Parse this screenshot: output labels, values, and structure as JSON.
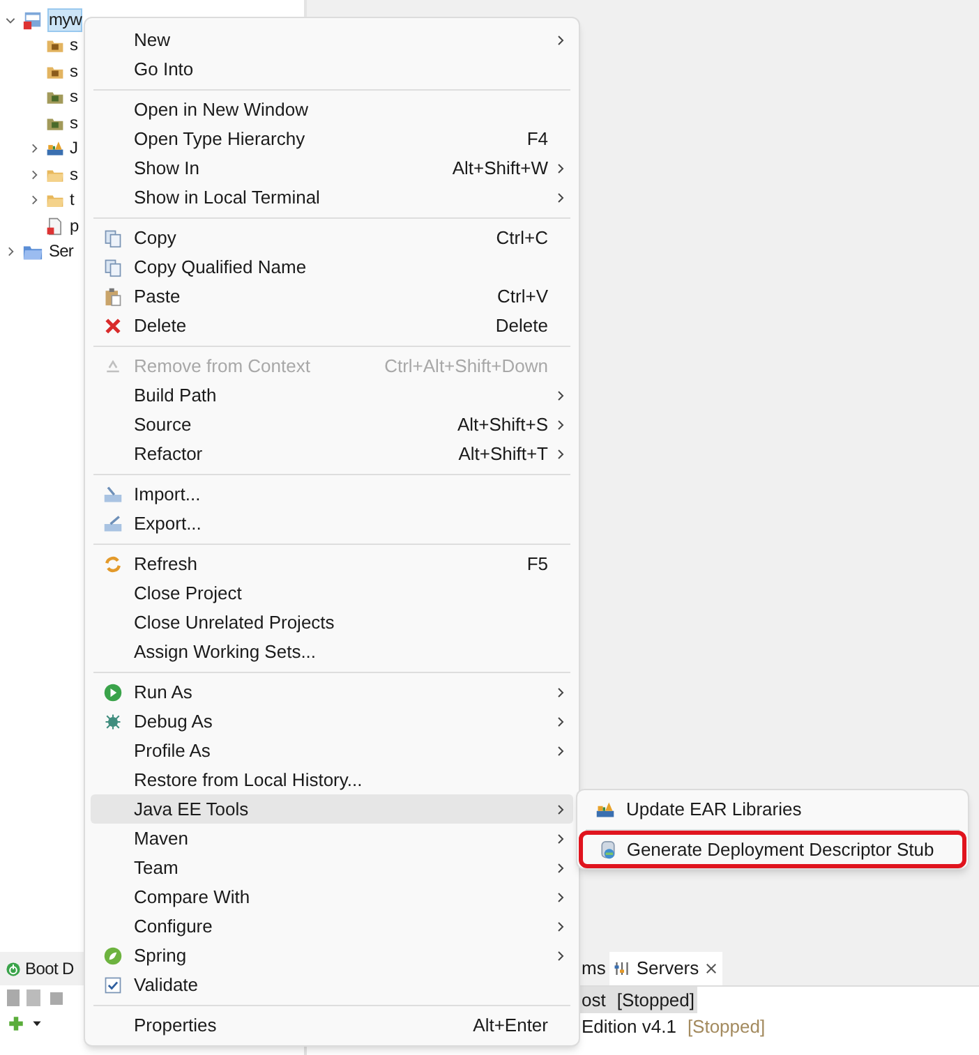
{
  "project_tree": {
    "items": [
      {
        "label": "myw",
        "kind": "webproject",
        "selected": true,
        "expanded": true,
        "children": [
          {
            "label": "s",
            "kind": "package"
          },
          {
            "label": "s",
            "kind": "package"
          },
          {
            "label": "s",
            "kind": "resources"
          },
          {
            "label": "s",
            "kind": "resources"
          },
          {
            "label": "J",
            "kind": "library",
            "expanded": false
          },
          {
            "label": "s",
            "kind": "folder",
            "expanded": false
          },
          {
            "label": "t",
            "kind": "folder",
            "expanded": false
          },
          {
            "label": "p",
            "kind": "file"
          }
        ]
      },
      {
        "label": "Ser",
        "kind": "serverfolder",
        "selected": false,
        "expanded": false
      }
    ]
  },
  "boot_panel": {
    "tab": "Boot D"
  },
  "servers_panel": {
    "tabs": [
      {
        "label": "ms",
        "selected": false
      },
      {
        "label": "Servers",
        "selected": true
      }
    ],
    "rows": [
      {
        "name": "ost",
        "state": "[Stopped]",
        "selected": true
      },
      {
        "name": "Edition v4.1",
        "state": "[Stopped]",
        "selected": false
      }
    ]
  },
  "context_menu": {
    "items": [
      {
        "kind": "plain",
        "label": "New",
        "submenu": true
      },
      {
        "kind": "plain",
        "label": "Go Into"
      },
      {
        "kind": "separator"
      },
      {
        "kind": "plain",
        "label": "Open in New Window"
      },
      {
        "kind": "plain",
        "label": "Open Type Hierarchy",
        "shortcut": "F4"
      },
      {
        "kind": "plain",
        "label": "Show In",
        "shortcut": "Alt+Shift+W",
        "submenu": true
      },
      {
        "kind": "plain",
        "label": "Show in Local Terminal",
        "submenu": true
      },
      {
        "kind": "separator"
      },
      {
        "kind": "copy",
        "label": "Copy",
        "shortcut": "Ctrl+C"
      },
      {
        "kind": "copy",
        "label": "Copy Qualified Name"
      },
      {
        "kind": "paste",
        "label": "Paste",
        "shortcut": "Ctrl+V"
      },
      {
        "kind": "delete",
        "label": "Delete",
        "shortcut": "Delete"
      },
      {
        "kind": "separator"
      },
      {
        "kind": "remove",
        "label": "Remove from Context",
        "shortcut": "Ctrl+Alt+Shift+Down",
        "disabled": true
      },
      {
        "kind": "plain",
        "label": "Build Path",
        "submenu": true
      },
      {
        "kind": "plain",
        "label": "Source",
        "shortcut": "Alt+Shift+S",
        "submenu": true
      },
      {
        "kind": "plain",
        "label": "Refactor",
        "shortcut": "Alt+Shift+T",
        "submenu": true
      },
      {
        "kind": "separator"
      },
      {
        "kind": "import",
        "label": "Import..."
      },
      {
        "kind": "export",
        "label": "Export..."
      },
      {
        "kind": "separator"
      },
      {
        "kind": "refresh",
        "label": "Refresh",
        "shortcut": "F5"
      },
      {
        "kind": "plain",
        "label": "Close Project"
      },
      {
        "kind": "plain",
        "label": "Close Unrelated Projects"
      },
      {
        "kind": "plain",
        "label": "Assign Working Sets..."
      },
      {
        "kind": "separator"
      },
      {
        "kind": "run",
        "label": "Run As",
        "submenu": true
      },
      {
        "kind": "debug",
        "label": "Debug As",
        "submenu": true
      },
      {
        "kind": "plain",
        "label": "Profile As",
        "submenu": true
      },
      {
        "kind": "plain",
        "label": "Restore from Local History..."
      },
      {
        "kind": "plain",
        "label": "Java EE Tools",
        "submenu": true,
        "selected": true
      },
      {
        "kind": "plain",
        "label": "Maven",
        "submenu": true
      },
      {
        "kind": "plain",
        "label": "Team",
        "submenu": true
      },
      {
        "kind": "plain",
        "label": "Compare With",
        "submenu": true
      },
      {
        "kind": "plain",
        "label": "Configure",
        "submenu": true
      },
      {
        "kind": "spring",
        "label": "Spring",
        "submenu": true
      },
      {
        "kind": "validate",
        "label": "Validate"
      },
      {
        "kind": "separator"
      },
      {
        "kind": "plain",
        "label": "Properties",
        "shortcut": "Alt+Enter"
      }
    ]
  },
  "submenu": {
    "items": [
      {
        "kind": "library",
        "label": "Update EAR Libraries",
        "outlined": false
      },
      {
        "kind": "separator"
      },
      {
        "kind": "descriptor",
        "label": "Generate Deployment Descriptor Stub",
        "outlined": true
      }
    ]
  }
}
